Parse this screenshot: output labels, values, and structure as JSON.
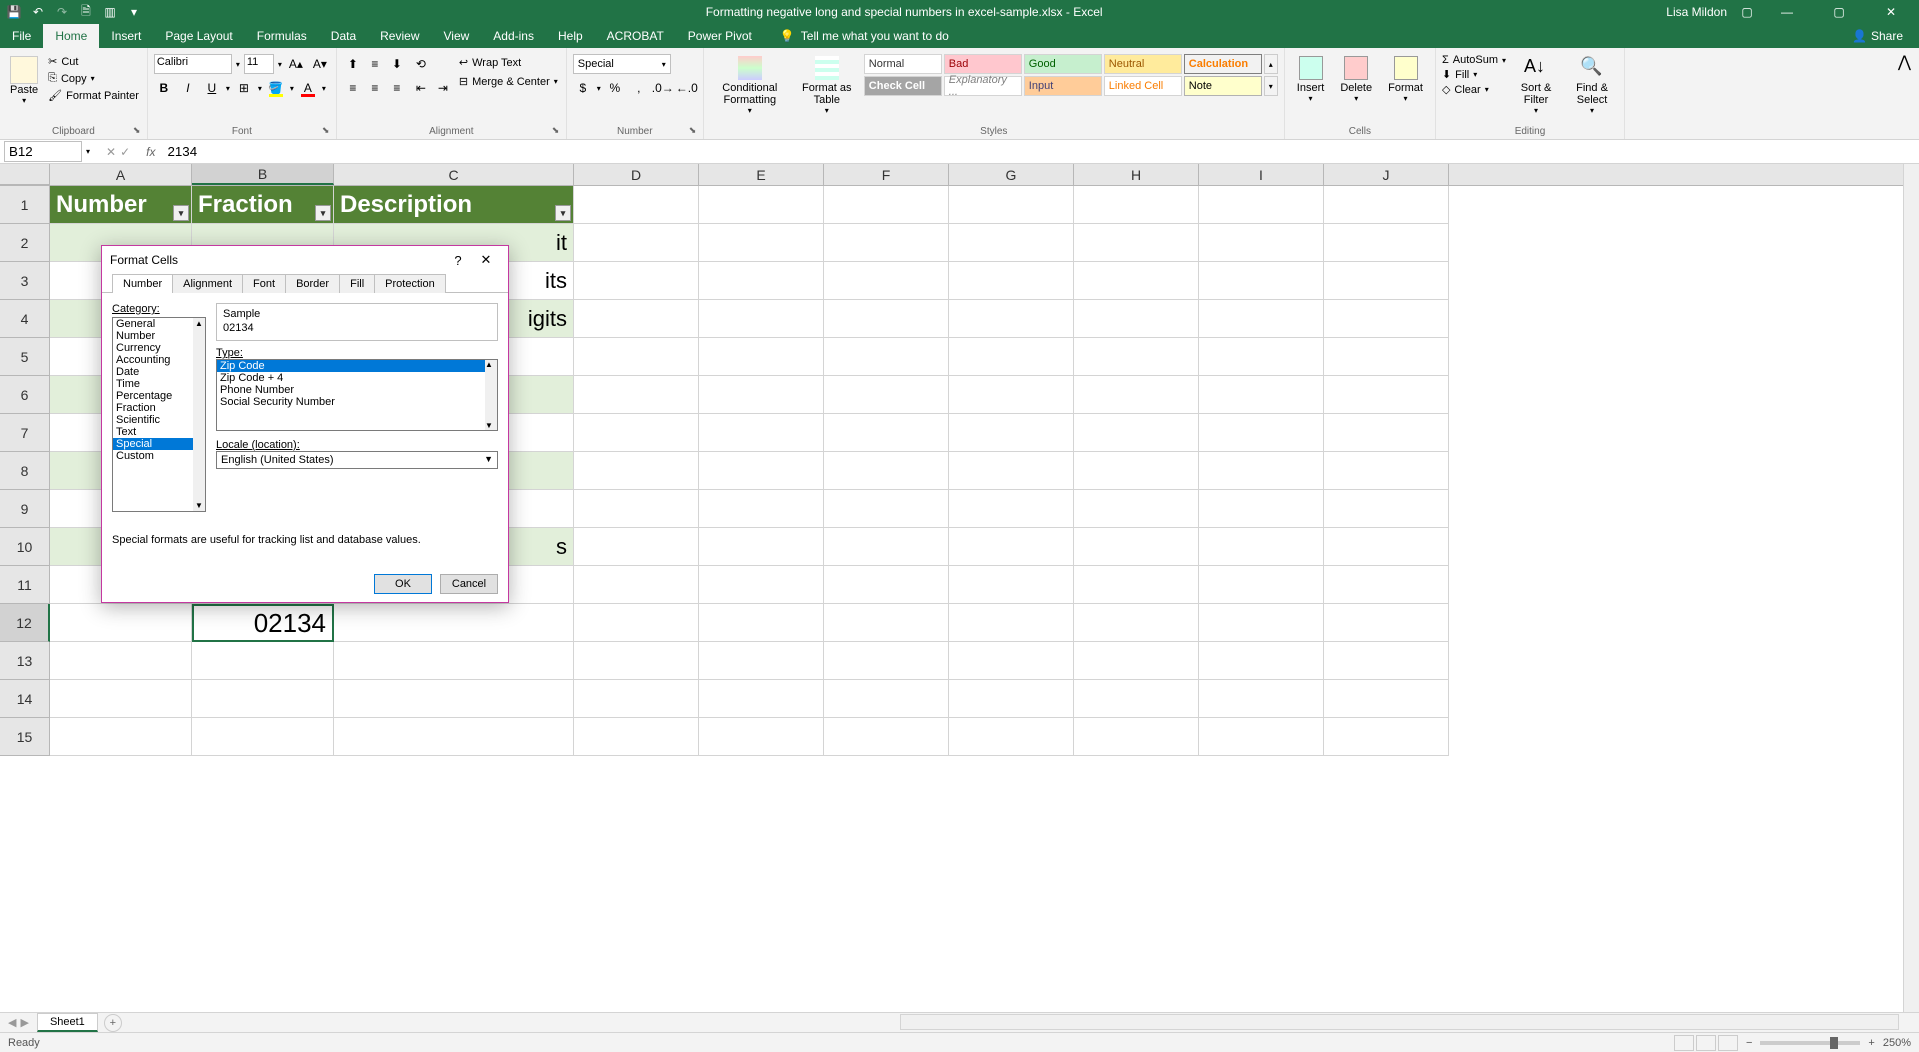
{
  "title": {
    "filename": "Formatting negative long and special numbers in excel-sample.xlsx",
    "app": "Excel",
    "user": "Lisa Mildon"
  },
  "tabs": {
    "file": "File",
    "home": "Home",
    "insert": "Insert",
    "pageLayout": "Page Layout",
    "formulas": "Formulas",
    "data": "Data",
    "review": "Review",
    "view": "View",
    "addins": "Add-ins",
    "help": "Help",
    "acrobat": "ACROBAT",
    "powerpivot": "Power Pivot",
    "tellme": "Tell me what you want to do",
    "share": "Share"
  },
  "ribbon": {
    "clipboard": {
      "paste": "Paste",
      "cut": "Cut",
      "copy": "Copy",
      "formatPainter": "Format Painter",
      "label": "Clipboard"
    },
    "font": {
      "name": "Calibri",
      "size": "11",
      "label": "Font"
    },
    "alignment": {
      "wrap": "Wrap Text",
      "merge": "Merge & Center",
      "label": "Alignment"
    },
    "number": {
      "format": "Special",
      "label": "Number"
    },
    "styles": {
      "conditional": "Conditional Formatting",
      "formatAs": "Format as Table",
      "normal": "Normal",
      "bad": "Bad",
      "good": "Good",
      "neutral": "Neutral",
      "calculation": "Calculation",
      "checkCell": "Check Cell",
      "explanatory": "Explanatory ...",
      "input": "Input",
      "linkedCell": "Linked Cell",
      "note": "Note",
      "label": "Styles"
    },
    "cells": {
      "insert": "Insert",
      "delete": "Delete",
      "format": "Format",
      "label": "Cells"
    },
    "editing": {
      "autosum": "AutoSum",
      "fill": "Fill",
      "clear": "Clear",
      "sort": "Sort & Filter",
      "find": "Find & Select",
      "label": "Editing"
    }
  },
  "formulaBar": {
    "nameBox": "B12",
    "formula": "2134"
  },
  "colHeads": [
    "A",
    "B",
    "C",
    "D",
    "E",
    "F",
    "G",
    "H",
    "I",
    "J"
  ],
  "rowHeads": [
    "1",
    "2",
    "3",
    "4",
    "5",
    "6",
    "7",
    "8",
    "9",
    "10",
    "11",
    "12",
    "13",
    "14",
    "15"
  ],
  "sheet": {
    "headers": {
      "a": "Number",
      "b": "Fraction",
      "c": "Description"
    },
    "visibleFragments": {
      "c2": "it",
      "c3": "its",
      "c4": "igits",
      "c10": "s"
    },
    "b12": "02134"
  },
  "dialog": {
    "title": "Format Cells",
    "tabs": {
      "number": "Number",
      "alignment": "Alignment",
      "font": "Font",
      "border": "Border",
      "fill": "Fill",
      "protection": "Protection"
    },
    "categoryLabel": "Category:",
    "categories": [
      "General",
      "Number",
      "Currency",
      "Accounting",
      "Date",
      "Time",
      "Percentage",
      "Fraction",
      "Scientific",
      "Text",
      "Special",
      "Custom"
    ],
    "selectedCategory": "Special",
    "sampleLabel": "Sample",
    "sampleValue": "02134",
    "typeLabel": "Type:",
    "types": [
      "Zip Code",
      "Zip Code + 4",
      "Phone Number",
      "Social Security Number"
    ],
    "selectedType": "Zip Code",
    "localeLabel": "Locale (location):",
    "locale": "English (United States)",
    "description": "Special formats are useful for tracking list and database values.",
    "ok": "OK",
    "cancel": "Cancel"
  },
  "sheetTabs": {
    "sheet1": "Sheet1"
  },
  "status": {
    "ready": "Ready",
    "zoom": "250%"
  }
}
